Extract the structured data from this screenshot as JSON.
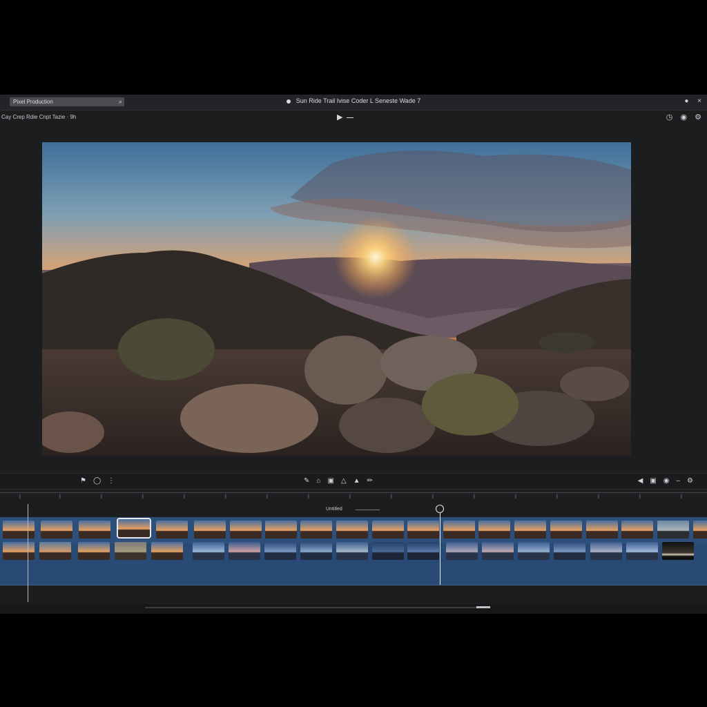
{
  "titlebar": {
    "search_value": "Pixel Production",
    "title": "Sun Ride Trail Ivise Coder L Seneste Wade 7",
    "close_glyph": "×"
  },
  "toolbar": {
    "breadcrumb": "Cay Crep Rdie Cnpt Tazie  ·  9h"
  },
  "timeline": {
    "sequence_label": "Untitled"
  }
}
